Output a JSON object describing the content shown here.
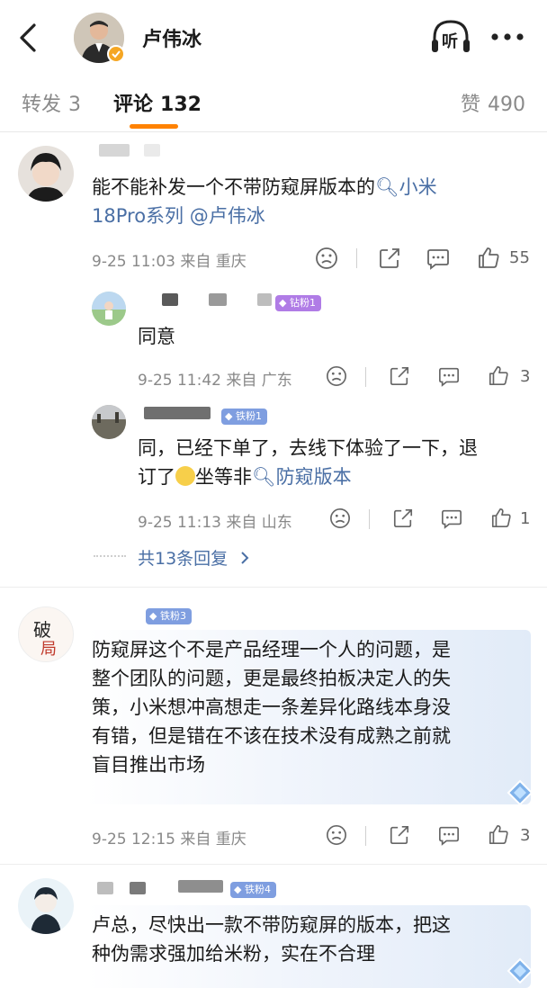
{
  "header": {
    "back_icon": "chevron-left-icon",
    "user_name": "卢伟冰",
    "listen_label": "听",
    "more_icon": "more-dots-icon"
  },
  "tabs": [
    {
      "label": "转发",
      "count": "3"
    },
    {
      "label": "评论",
      "count": "132"
    },
    {
      "label": "赞",
      "count": "490"
    }
  ],
  "comments": [
    {
      "text_part1": "能不能补发一个不带防窥屏版本的",
      "topic_link": "小米",
      "text_line2_link": "18Pro系列",
      "mention": "@卢伟冰",
      "time": "9-25 11:03",
      "from": "来自 重庆",
      "likes": "55",
      "replies": [
        {
          "badge": "钻粉1",
          "text": "同意",
          "time": "9-25 11:42",
          "from": "来自 广东",
          "likes": "3"
        },
        {
          "badge": "铁粉1",
          "text_line1": "同，已经下单了，去线下体验了一下，退",
          "text_line2_prefix": "订了",
          "text_line2_mid": "坐等非",
          "topic_link": "防窥版本",
          "time": "9-25 11:13",
          "from": "来自 山东",
          "likes": "1"
        }
      ],
      "more_replies": "共13条回复"
    },
    {
      "badge": "铁粉3",
      "lines": [
        "防窥屏这个不是产品经理一个人的问题，是",
        "整个团队的问题，更是最终拍板决定人的失",
        "策，小米想冲高想走一条差异化路线本身没",
        "有错，但是错在不该在技术没有成熟之前就",
        "盲目推出市场"
      ],
      "time": "9-25 12:15",
      "from": "来自 重庆",
      "likes": "3"
    },
    {
      "badge": "铁粉4",
      "lines": [
        "卢总，尽快出一款不带防窥屏的版本，把这",
        "种伪需求强加给米粉，实在不合理"
      ]
    }
  ],
  "colors": {
    "accent": "#ff8200",
    "link": "#4a6fa5",
    "iron_badge": "#7f9ee0",
    "diamond_badge": "#b07ce6"
  }
}
